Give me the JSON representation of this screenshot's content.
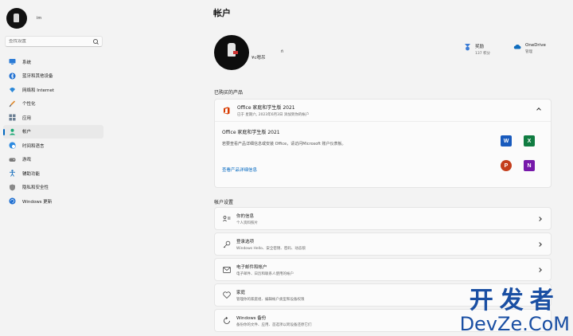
{
  "sidebar": {
    "profile_name": "im",
    "search_placeholder": "查找设置",
    "items": [
      {
        "label": "系统",
        "icon": "monitor-icon"
      },
      {
        "label": "蓝牙和其他设备",
        "icon": "bluetooth-icon"
      },
      {
        "label": "网络和 Internet",
        "icon": "network-icon"
      },
      {
        "label": "个性化",
        "icon": "brush-icon"
      },
      {
        "label": "应用",
        "icon": "apps-icon"
      },
      {
        "label": "帐户",
        "icon": "account-icon",
        "active": true
      },
      {
        "label": "时间和语言",
        "icon": "globe-clock-icon"
      },
      {
        "label": "游戏",
        "icon": "gamepad-icon"
      },
      {
        "label": "辅助功能",
        "icon": "accessibility-icon"
      },
      {
        "label": "隐私和安全性",
        "icon": "shield-icon"
      },
      {
        "label": "Windows 更新",
        "icon": "update-icon"
      }
    ]
  },
  "main": {
    "title": "帐户",
    "username": "¥c嗯吊",
    "username_small": "ñ",
    "rewards": {
      "title": "奖励",
      "sub": "137 积分"
    },
    "onedrive": {
      "title": "OneDrive",
      "sub": "管理"
    },
    "purchased_section": "已购买的产品",
    "office": {
      "title": "Office 家庭和学生版 2021",
      "subtitle": "已于 星期六, 2023年6月3日 添加到你的帐户",
      "product_name": "Office 家庭和学生版 2021",
      "description": "若要查看产品详细信息或安装 Office，请访问Microsoft 账户仪表板。",
      "link": "查看产品详细信息"
    },
    "apps": [
      {
        "name": "word-icon",
        "letter": "W",
        "color": "#185abd"
      },
      {
        "name": "excel-icon",
        "letter": "X",
        "color": "#107c41"
      },
      {
        "name": "powerpoint-icon",
        "letter": "P",
        "color": "#c43e1c"
      },
      {
        "name": "onenote-icon",
        "letter": "N",
        "color": "#7719aa"
      }
    ],
    "account_section": "帐户设置",
    "rows": [
      {
        "title": "你的信息",
        "sub": "个人资料照片",
        "icon": "person-card-icon"
      },
      {
        "title": "登录选项",
        "sub": "Windows Hello、安全密钥、密码、动态锁",
        "icon": "key-icon"
      },
      {
        "title": "电子邮件和帐户",
        "sub": "电子邮件、日历和联系人使用的帐户",
        "icon": "mail-icon"
      },
      {
        "title": "家庭",
        "sub": "管理你的家庭组、编辑帐户类型和设备权限",
        "icon": "heart-icon"
      },
      {
        "title": "Windows 备份",
        "sub": "备份你的文件、应用、首选项以跨设备还原它们",
        "icon": "backup-icon"
      }
    ]
  },
  "watermark": {
    "cn": "开发者",
    "en": "DevZe.CoM"
  }
}
